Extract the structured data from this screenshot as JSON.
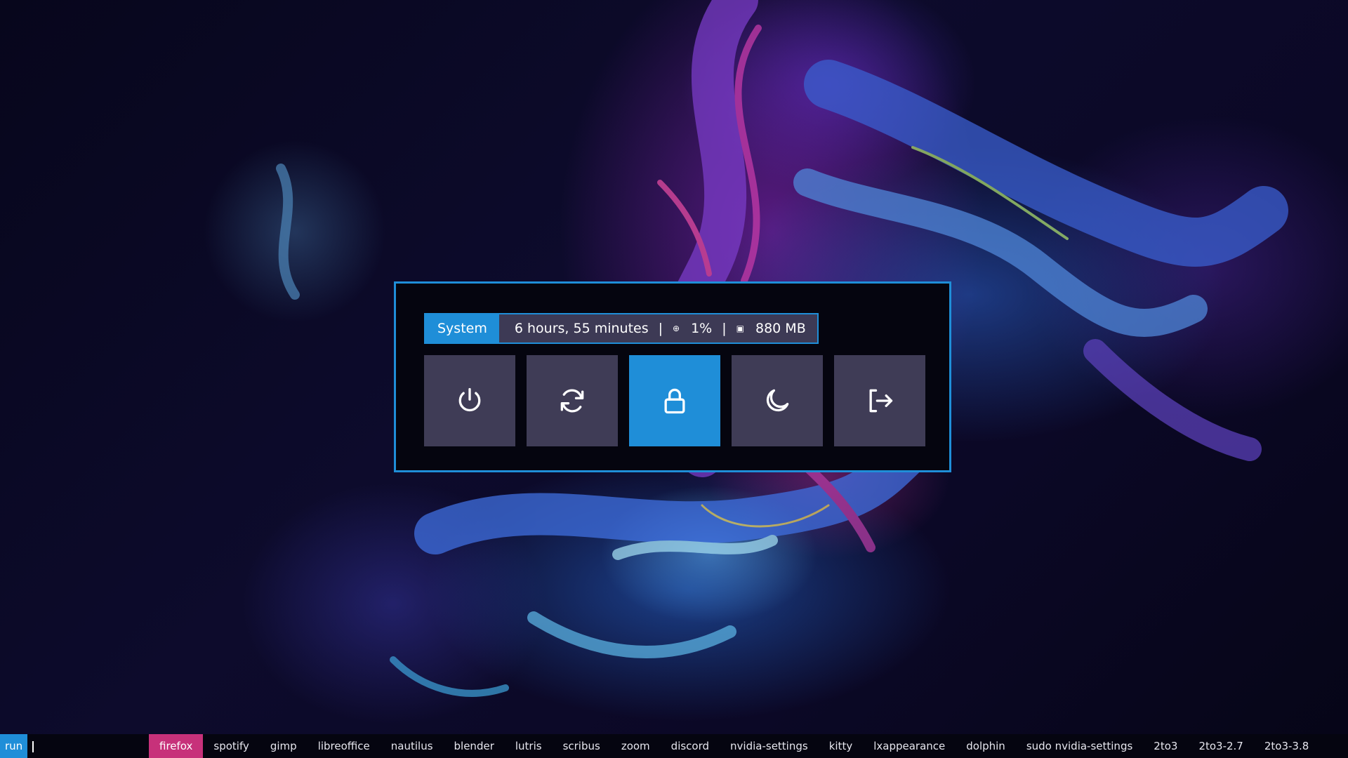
{
  "power_menu": {
    "title": "System",
    "uptime": "6 hours, 55 minutes",
    "separator": "|",
    "cpu_icon": "cpu-icon",
    "cpu": "1%",
    "memory_icon": "memory-icon",
    "memory": "880 MB",
    "buttons": [
      {
        "name": "shutdown",
        "icon": "power-icon"
      },
      {
        "name": "reboot",
        "icon": "refresh-icon"
      },
      {
        "name": "lock",
        "icon": "lock-icon",
        "selected": true
      },
      {
        "name": "suspend",
        "icon": "moon-icon"
      },
      {
        "name": "logout",
        "icon": "logout-icon"
      }
    ]
  },
  "runbar": {
    "prompt": "run",
    "input_value": "",
    "items": [
      "firefox",
      "spotify",
      "gimp",
      "libreoffice",
      "nautilus",
      "blender",
      "lutris",
      "scribus",
      "zoom",
      "discord",
      "nvidia-settings",
      "kitty",
      "lxappearance",
      "dolphin",
      "sudo nvidia-settings",
      "2to3",
      "2to3-2.7",
      "2to3-3.8"
    ],
    "selected_item": "firefox"
  },
  "colors": {
    "accent": "#1f8ed8",
    "selection": "#c7317a",
    "button": "#3f3c56",
    "window_bg": "#05050f"
  }
}
